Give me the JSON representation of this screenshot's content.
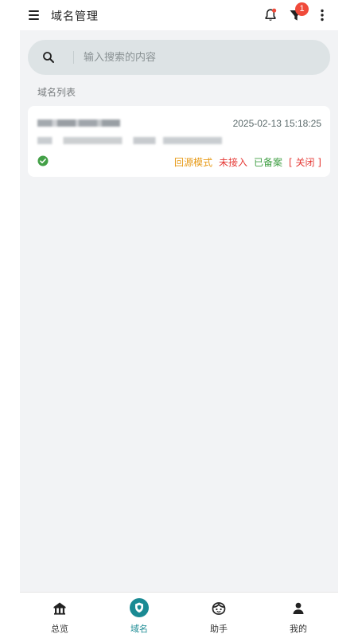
{
  "header": {
    "title": "域名管理",
    "filter_badge": "1"
  },
  "search": {
    "placeholder": "输入搜索的内容",
    "value": ""
  },
  "section_label": "域名列表",
  "domains": [
    {
      "timestamp": "2025-02-13 15:18:25",
      "status_icon": "check-circle-icon",
      "tags": {
        "origin_mode": "回源模式",
        "not_connected": "未接入",
        "registered": "已备案",
        "close": "[ 关闭 ]"
      }
    }
  ],
  "colors": {
    "accent": "#1a8a93",
    "origin_mode": "#e79a17",
    "not_connected": "#e53935",
    "registered": "#43a047",
    "close": "#e53935",
    "status_ok": "#43a047"
  },
  "bottom_nav": [
    {
      "label": "总览",
      "icon": "home-icon"
    },
    {
      "label": "域名",
      "icon": "shield-icon"
    },
    {
      "label": "助手",
      "icon": "assistant-face-icon"
    },
    {
      "label": "我的",
      "icon": "user-icon"
    }
  ]
}
